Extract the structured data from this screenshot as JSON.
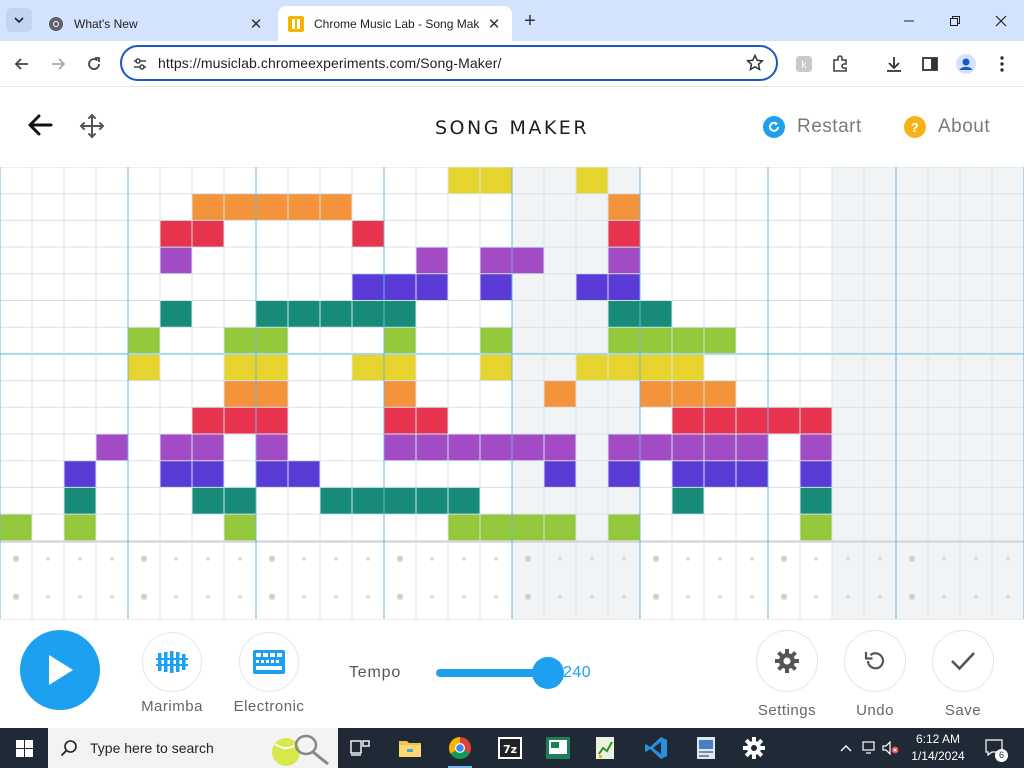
{
  "browser": {
    "tabs": [
      {
        "title": "What's New",
        "active": false
      },
      {
        "title": "Chrome Music Lab - Song Mak",
        "active": true
      }
    ],
    "url": "https://musiclab.chromeexperiments.com/Song-Maker/"
  },
  "app": {
    "title": "SONG MAKER",
    "restart_label": "Restart",
    "about_label": "About",
    "about_icon_text": "?"
  },
  "grid": {
    "columns": 32,
    "rows": 14,
    "percussion_rows": 2,
    "bars_every": 4,
    "shaded_column_ranges": [
      [
        16,
        19
      ],
      [
        26,
        31
      ]
    ],
    "row_colors": [
      "#e7d42e",
      "#f4933a",
      "#e8334e",
      "#a34bc4",
      "#5a3bd6",
      "#188a78",
      "#94c73a",
      "#e7d42e",
      "#f4933a",
      "#e8334e",
      "#a34bc4",
      "#5a3bd6",
      "#188a78",
      "#94c73a"
    ],
    "notes": [
      [
        0,
        [
          14,
          15,
          18
        ]
      ],
      [
        1,
        [
          6,
          7,
          8,
          9,
          10,
          19
        ]
      ],
      [
        2,
        [
          5,
          6,
          11,
          19
        ]
      ],
      [
        3,
        [
          5,
          13,
          15,
          16,
          19
        ]
      ],
      [
        4,
        [
          11,
          12,
          13,
          15,
          18,
          19
        ]
      ],
      [
        5,
        [
          5,
          8,
          9,
          10,
          11,
          12,
          19,
          20
        ]
      ],
      [
        6,
        [
          4,
          7,
          8,
          12,
          15,
          19,
          20,
          21,
          22
        ]
      ],
      [
        7,
        [
          4,
          7,
          8,
          11,
          12,
          15,
          18,
          19,
          20,
          21
        ]
      ],
      [
        8,
        [
          7,
          8,
          12,
          17,
          20,
          21,
          22
        ]
      ],
      [
        9,
        [
          6,
          7,
          8,
          12,
          13,
          21,
          22,
          23,
          24,
          25
        ]
      ],
      [
        10,
        [
          3,
          5,
          6,
          8,
          12,
          13,
          14,
          15,
          16,
          17,
          19,
          20,
          21,
          22,
          23,
          25
        ]
      ],
      [
        11,
        [
          2,
          5,
          6,
          8,
          9,
          17,
          19,
          21,
          22,
          23,
          25
        ]
      ],
      [
        12,
        [
          2,
          6,
          7,
          10,
          11,
          12,
          13,
          14,
          21,
          25
        ]
      ],
      [
        13,
        [
          0,
          2,
          7,
          14,
          15,
          16,
          17,
          19,
          25
        ]
      ]
    ]
  },
  "controls": {
    "instrument_1": "Marimba",
    "instrument_2": "Electronic",
    "tempo_label": "Tempo",
    "tempo_value": "240",
    "tempo_fraction": 0.98,
    "settings_label": "Settings",
    "undo_label": "Undo",
    "save_label": "Save"
  },
  "taskbar": {
    "search_placeholder": "Type here to search",
    "time": "6:12 AM",
    "date": "1/14/2024",
    "notification_count": "6"
  },
  "colors": {
    "accent": "#1ea0f0",
    "grid_line": "#cfe3ee",
    "bar_line": "#6fb6d9"
  }
}
